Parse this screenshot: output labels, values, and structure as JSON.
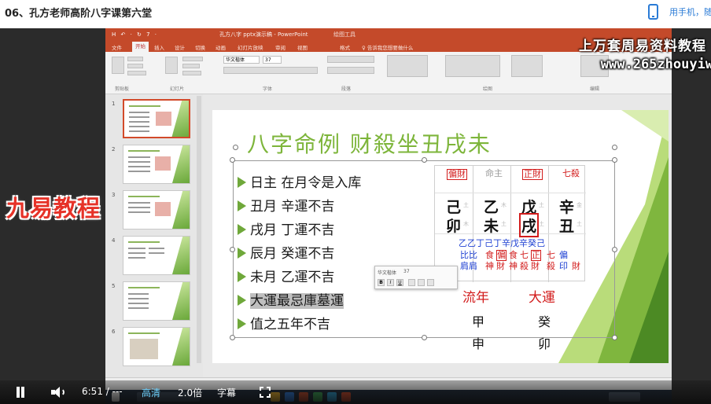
{
  "page": {
    "title": "06、孔方老师高阶八字课第六堂",
    "phone_link": "用手机，随"
  },
  "ppt": {
    "quick_access": "H ↶ · ↻ 7 ·",
    "doc_title": "孔方八字 pptx演示稿 - PowerPoint",
    "tool_tab": "绘图工具",
    "tabs": [
      "文件",
      "开始",
      "插入",
      "设计",
      "切换",
      "动画",
      "幻灯片放映",
      "审阅",
      "视图",
      "格式",
      "♀ 告诉我您想要做什么"
    ],
    "ribbon_groups": [
      "剪贴板",
      "幻灯片",
      "字体",
      "段落",
      "绘图",
      "编辑"
    ],
    "font_name": "华文楷体",
    "font_size": "37"
  },
  "overlay": {
    "brand": "上万套周易资料教程",
    "url": "www.265zhouyiw.com",
    "jiuyi": "九易教程"
  },
  "thumbnails": [
    {
      "num": "1",
      "active": true
    },
    {
      "num": "2",
      "active": false
    },
    {
      "num": "3",
      "active": false
    },
    {
      "num": "4",
      "active": false
    },
    {
      "num": "5",
      "active": false
    },
    {
      "num": "6",
      "active": false
    }
  ],
  "slide": {
    "title": "八字命例 财殺坐丑戌未",
    "bullets": [
      "日主 在月令是入库",
      "丑月 辛運不吉",
      "戌月 丁運不吉",
      "辰月 癸運不吉",
      "未月 乙運不吉",
      "大運最忌庫墓運",
      "值之五年不吉"
    ],
    "bazi": {
      "gods_top": [
        "偏財",
        "命主",
        "正財",
        "七殺"
      ],
      "stems": [
        "己",
        "乙",
        "戊",
        "辛"
      ],
      "branches": [
        "卯",
        "未",
        "戌",
        "丑"
      ],
      "small_marks": [
        "土",
        "木",
        "土",
        "金",
        "木",
        "土",
        "土",
        "土"
      ],
      "hidden_stems": "乙乙丁己丁辛戊辛癸己",
      "hidden_caps_top": [
        "比",
        "比",
        "食",
        "偏",
        "食",
        "七",
        "正",
        "七",
        "偏"
      ],
      "hidden_caps_bot": [
        "肩",
        "肩",
        "神",
        "財",
        "神",
        "殺",
        "財",
        "殺",
        "印",
        "財"
      ]
    },
    "liunian_label": "流年",
    "dayun_label": "大運",
    "liunian_values": [
      "甲",
      "申"
    ],
    "dayun_values": [
      "癸",
      "卯"
    ]
  },
  "mini_toolbar": {
    "font": "华文楷体",
    "size": "37",
    "buttons": [
      "B",
      "I",
      "U"
    ]
  },
  "player": {
    "time": "6:51 / ---",
    "quality": "高清",
    "speed": "2.0倍",
    "subtitle": "字幕"
  },
  "colors": {
    "ppt_accent": "#c44a2a",
    "title_green": "#7db53a",
    "bazi_red": "#d21c1c",
    "hidden_blue": "#1c3fd2"
  }
}
